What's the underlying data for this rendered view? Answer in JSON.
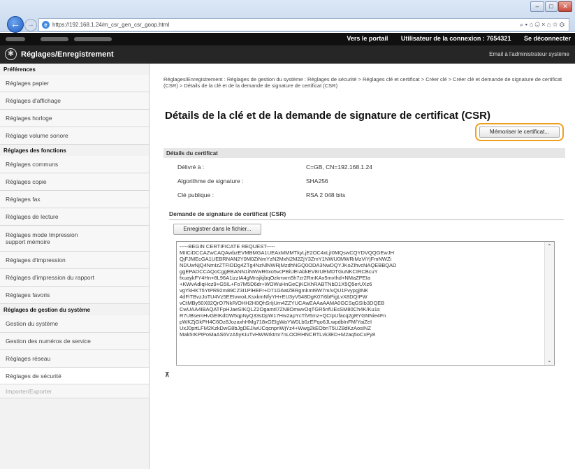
{
  "browser": {
    "url": "https://192.168.1.24/m_csr_gen_csr_goop.html",
    "toolbar_icons": "⌕ ▾ ⌂ ☹ ×  ⌂ ☆ ⚙",
    "min": "–",
    "max": "□",
    "close": "✕"
  },
  "topbar": {
    "portal": "Vers le portail",
    "login_user": "Utilisateur de la connexion : 7654321",
    "logout": "Se déconnecter"
  },
  "header": {
    "title": "Réglages/Enregistrement",
    "mail": "Email à l'administrateur système"
  },
  "sidebar": [
    {
      "type": "section",
      "label": "Préférences"
    },
    {
      "type": "item",
      "label": "Réglages papier"
    },
    {
      "type": "item",
      "label": "Réglages d'affichage"
    },
    {
      "type": "item",
      "label": "Réglages horloge"
    },
    {
      "type": "item",
      "label": "Réglage volume sonore"
    },
    {
      "type": "section",
      "label": "Réglages des fonctions"
    },
    {
      "type": "item",
      "label": "Réglages communs"
    },
    {
      "type": "item",
      "label": "Réglages copie"
    },
    {
      "type": "item",
      "label": "Réglages fax"
    },
    {
      "type": "item",
      "label": "Réglages de lecture"
    },
    {
      "type": "item2",
      "label": "Réglages mode Impression",
      "label2": "support mémoire"
    },
    {
      "type": "item",
      "label": "Réglages d'impression"
    },
    {
      "type": "item",
      "label": "Réglages d'impression du rapport"
    },
    {
      "type": "item",
      "label": "Réglages favoris"
    },
    {
      "type": "section",
      "label": "Réglages de gestion du système"
    },
    {
      "type": "item",
      "label": "Gestion du système"
    },
    {
      "type": "item",
      "label": "Gestion des numéros de service"
    },
    {
      "type": "item",
      "label": "Réglages réseau"
    },
    {
      "type": "item-active",
      "label": "Réglages de sécurité"
    },
    {
      "type": "item-dim",
      "label": "Importer/Exporter"
    }
  ],
  "breadcrumb": "Réglages/Enregistrement : Réglages de gestion du système : Réglages de sécurité > Réglages clé et certificat > Créer clé > Créer clé et demande de signature de certificat (CSR) > Détails de la clé et de la demande de signature de certificat (CSR)",
  "page_title": "Détails de la clé et de la demande de signature de certificat (CSR)",
  "store_button": "Mémoriser le certificat...",
  "details": {
    "header": "Détails du certificat",
    "rows": [
      {
        "label": "Délivré à :",
        "value": "C=GB, CN=192.168.1.24"
      },
      {
        "label": "Algorithme de signature :",
        "value": "SHA256"
      },
      {
        "label": "Clé publique :",
        "value": "RSA 2 048 bits"
      }
    ]
  },
  "csr": {
    "header": "Demande de signature de certificat (CSR)",
    "save_button": "Enregistrer dans le fichier...",
    "text": "-----BEGIN CERTIFICATE REQUEST-----\nMIICiDCCAZwCAQAwbzEVMBMGA1UEAxMMMTkyLjE2OC4xLjI0MQswCQYDVQQGEwJH\nQjFJMEcGA1UEBRNAN2Y0M0ZiNmYzN2MxN2M2ZjY3ZmY1NWU0MWRiMzViYjFmNWZi\nNDUwNjQ4NmIzZTFiODg4ZTg4NzNlNWRjMzdhNGQ0ODA3NwDQYJKoZIhvcNAQEBBQAD\nggEPADCCAQoCggEBANN1iNWwR6xo5vcPBiUEIAbkEV8rUEMDTGuNKCIRCBcuY\nfxuaykFY4Hn+8L96A1izzIA4gMnsjkjbqOzkmxm5h7zr2RmKAx5mvIhd+NMaZPEIa\n+KWvAdIqHcz9+G5IL+Fo7M5D6dr+WOWuHnGeCjKCKhRABTNbD1X5Q5erUXz6\nvgYkHKT5YtPR92m89CZ3I1PiHEFr+D71G6atZBRgmkmt9W7m/vQU1FvypgjtNK\n4dFiTBvzJoTU4Vz5EEIvwoiLKsxkmNfyYH+EU3yV548DgK07i6bPigLvX8DQIPW\nvCtMBy50X82QrO7NkR/OHH2H0QhSrIjUm4ZZYUCAwEAAaAAMA0GCSqGSIb3DQEB\nCwUAA4IBAQATFpHJaeSIKQLZ2OgamtI7ZN8OmwvOqTGR5nfUEsSM80Ch4K/Ku1s\nR7UBsemHvGEIKdDW5qpNyQ33sDpW17Hw2apYcTlV6mz+QCIpUfacq2gRYGNNie4Fn\npWKZjGkPH4C6Oz8JozaxhHMg718xGEIgWaYW0Lb0zEPqo6JLwpdbInFM/YaiZeI\nUxJ0prtLFM2KzkDwG8bJgDEJ/wUCqcnpnWjYz4+Wwg2kEObnT5UZ8dKzAosINZ\nMak5rKPtPoMaAS6VzA5yKIuTvHWWrktmr7nLOORHNCRTLvk3ED+M2aq5oCxPy8"
  }
}
